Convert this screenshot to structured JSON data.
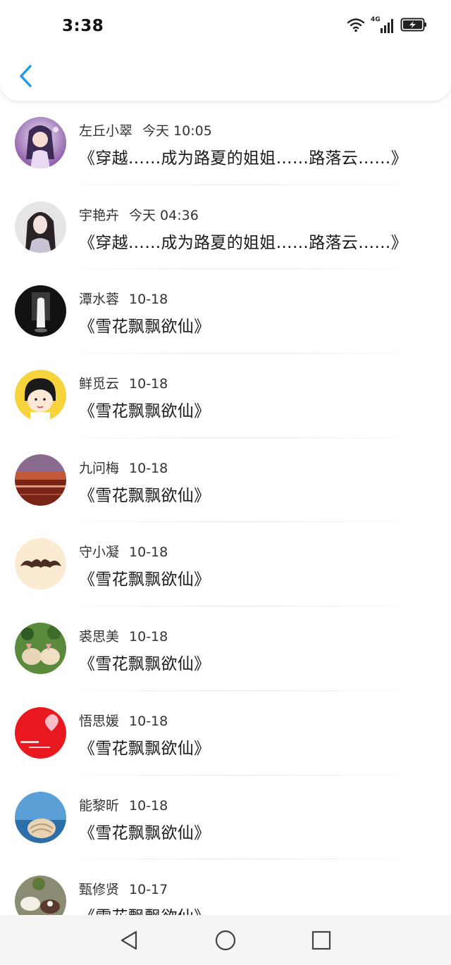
{
  "status_bar": {
    "time": "3:38",
    "icons": [
      "wifi-icon",
      "signal-4g-icon",
      "battery-charging-icon"
    ],
    "network_label": "4G"
  },
  "header": {
    "back_icon": "chevron-left-icon",
    "accent_color": "#1e9be6"
  },
  "items": [
    {
      "name": "左丘小翠",
      "time": "今天 10:05",
      "title": "《穿越……成为路夏的姐姐……路落云……》"
    },
    {
      "name": "宇艳卉",
      "time": "今天 04:36",
      "title": "《穿越……成为路夏的姐姐……路落云……》"
    },
    {
      "name": "潭水蓉",
      "time": "10-18",
      "title": "《雪花飘飘欲仙》"
    },
    {
      "name": "鲜觅云",
      "time": "10-18",
      "title": "《雪花飘飘欲仙》"
    },
    {
      "name": "九问梅",
      "time": "10-18",
      "title": "《雪花飘飘欲仙》"
    },
    {
      "name": "守小凝",
      "time": "10-18",
      "title": "《雪花飘飘欲仙》"
    },
    {
      "name": "裘思美",
      "time": "10-18",
      "title": "《雪花飘飘欲仙》"
    },
    {
      "name": "悟思媛",
      "time": "10-18",
      "title": "《雪花飘飘欲仙》"
    },
    {
      "name": "能黎昕",
      "time": "10-18",
      "title": "《雪花飘飘欲仙》"
    },
    {
      "name": "甄修贤",
      "time": "10-17",
      "title": "《雪花飘飘欲仙》"
    }
  ],
  "nav_bar": {
    "icons": [
      "back-triangle-icon",
      "home-circle-icon",
      "recents-square-icon"
    ]
  }
}
